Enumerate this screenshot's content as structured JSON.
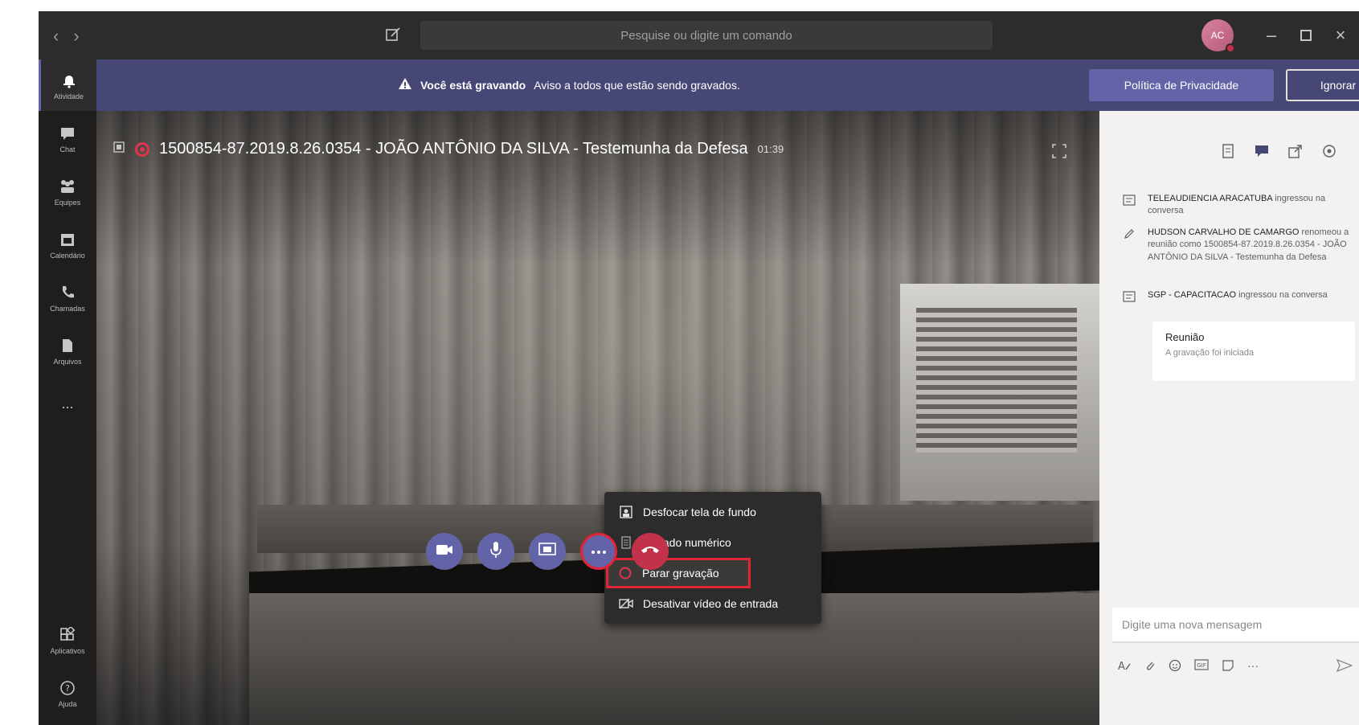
{
  "titlebar": {
    "search_placeholder": "Pesquise ou digite um comando",
    "avatar_initials": "AC"
  },
  "rail": {
    "items": [
      {
        "label": "Atividade",
        "icon": "bell-icon"
      },
      {
        "label": "Chat",
        "icon": "chat-icon"
      },
      {
        "label": "Equipes",
        "icon": "teams-icon"
      },
      {
        "label": "Calendário",
        "icon": "calendar-icon"
      },
      {
        "label": "Chamadas",
        "icon": "phone-icon"
      },
      {
        "label": "Arquivos",
        "icon": "file-icon"
      },
      {
        "label": "...",
        "icon": "more-icon"
      },
      {
        "label": "Aplicativos",
        "icon": "apps-icon"
      },
      {
        "label": "Ajuda",
        "icon": "help-icon"
      }
    ]
  },
  "banner": {
    "bold": "Você está gravando",
    "text": "Aviso a todos que estão sendo gravados.",
    "privacy_button": "Política de Privacidade",
    "ignore_button": "Ignorar"
  },
  "meeting": {
    "title": "1500854-87.2019.8.26.0354 - JOÃO ANTÔNIO DA SILVA - Testemunha da Defesa",
    "duration": "01:39"
  },
  "menu": {
    "items": [
      {
        "label": "Desfocar tela de fundo",
        "icon": "blur-icon"
      },
      {
        "label": "Teclado numérico",
        "icon": "dialpad-icon"
      },
      {
        "label": "Parar gravação",
        "icon": "stop-record-icon"
      },
      {
        "label": "Desativar vídeo de entrada",
        "icon": "video-off-icon"
      }
    ]
  },
  "controls": [
    "camera-icon",
    "mic-icon",
    "share-icon",
    "more-icon",
    "hangup-icon"
  ],
  "chat": {
    "events": [
      {
        "name": "TELEAUDIENCIA ARACATUBA",
        "text": " ingressou na conversa"
      },
      {
        "name": "HUDSON CARVALHO DE CAMARGO",
        "text": " renomeou a reunião como 1500854-87.2019.8.26.0354 - JOÃO ANTÔNIO DA SILVA - Testemunha da Defesa"
      },
      {
        "name": "SGP - CAPACITACAO",
        "text": " ingressou na conversa"
      }
    ],
    "card_title": "Reunião",
    "card_sub": "A gravação foi iniciada",
    "compose_placeholder": "Digite uma nova mensagem"
  },
  "colors": {
    "accent": "#6264a7",
    "banner": "#464775",
    "record_red": "#e32436"
  }
}
